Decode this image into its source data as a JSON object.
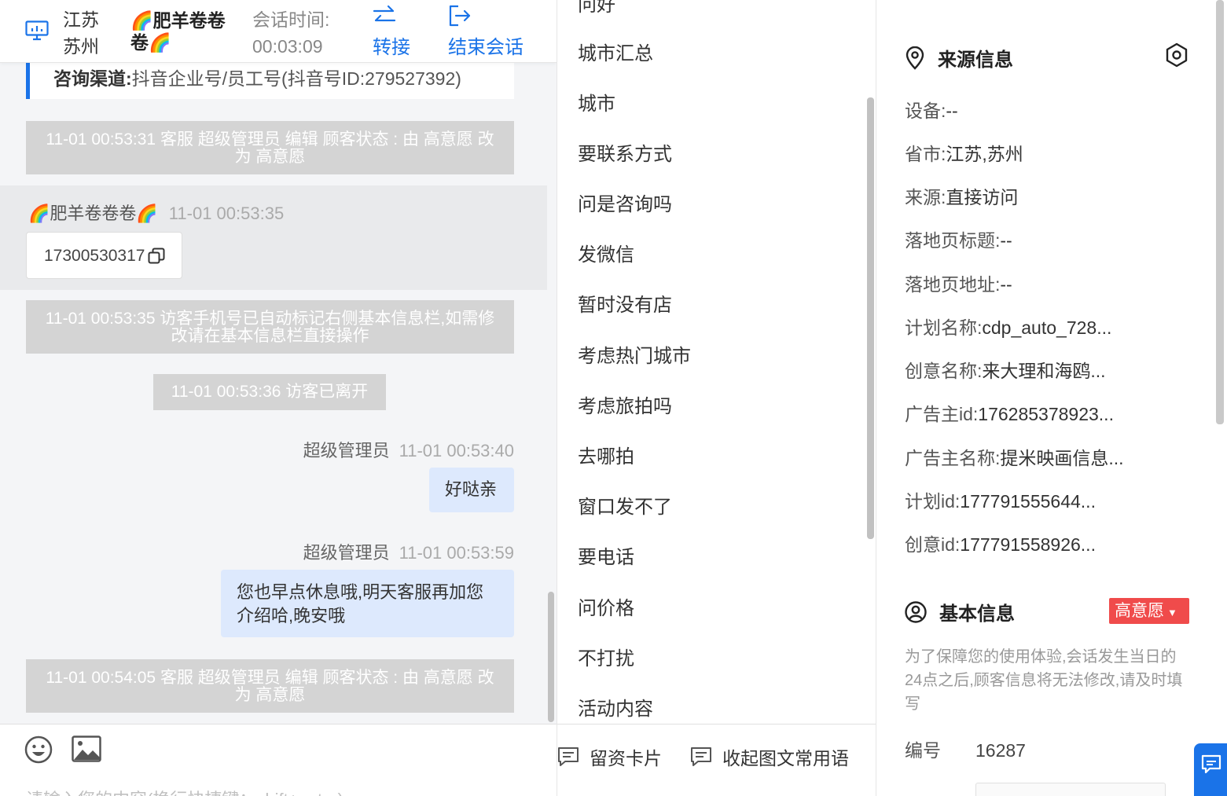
{
  "header": {
    "location": "江苏 苏州",
    "visitor_name": "🌈肥羊卷卷卷🌈",
    "session_time_label": "会话时间:",
    "session_time_value": "00:03:09",
    "transfer_label": "转接",
    "end_session_label": "结束会话"
  },
  "chat": {
    "channel_label": "咨询渠道:",
    "channel_value": "抖音企业号/员工号(抖音号ID:279527392)",
    "system_messages": [
      "11-01 00:53:31 客服 超级管理员 编辑 顾客状态 : 由 高意愿 改为 高意愿",
      "11-01 00:53:35 访客手机号已自动标记右侧基本信息栏,如需修改请在基本信息栏直接操作",
      "11-01 00:53:36 访客已离开",
      "11-01 00:54:05 客服 超级管理员 编辑 顾客状态 : 由 高意愿 改为 高意愿"
    ],
    "visitor_message": {
      "sender": "🌈肥羊卷卷卷🌈",
      "time": "11-01 00:53:35",
      "text": "17300530317"
    },
    "agent_messages": [
      {
        "sender": "超级管理员",
        "time": "11-01 00:53:40",
        "text": "好哒亲"
      },
      {
        "sender": "超级管理员",
        "time": "11-01 00:53:59",
        "text": "您也早点休息哦,明天客服再加您介绍哈,晚安哦"
      }
    ],
    "input_placeholder": "请输入您的内容(换行快捷键：shift+enter)"
  },
  "quick_replies": {
    "partial_top_item": "问好",
    "items": [
      "城市汇总",
      "城市",
      "要联系方式",
      "问是咨询吗",
      "发微信",
      "暂时没有店",
      "考虑热门城市",
      "考虑旅拍吗",
      "去哪拍",
      "窗口发不了",
      "要电话",
      "问价格",
      "不打扰",
      "活动内容"
    ],
    "card_label": "留资卡片",
    "collapse_label": "收起图文常用语"
  },
  "info": {
    "source_title": "来源信息",
    "source_rows": [
      {
        "key": "设备:",
        "value": "--"
      },
      {
        "key": "省市:",
        "value": "江苏,苏州"
      },
      {
        "key": "来源:",
        "value": "直接访问"
      },
      {
        "key": "落地页标题:",
        "value": "--"
      },
      {
        "key": "落地页地址:",
        "value": "--"
      },
      {
        "key": "计划名称:",
        "value": "cdp_auto_728..."
      },
      {
        "key": "创意名称:",
        "value": "来大理和海鸥..."
      },
      {
        "key": "广告主id:",
        "value": "176285378923..."
      },
      {
        "key": "广告主名称:",
        "value": "提米映画信息..."
      },
      {
        "key": "计划id:",
        "value": "177791555644..."
      },
      {
        "key": "创意id:",
        "value": "177791558926..."
      }
    ],
    "basic_title": "基本信息",
    "intent_badge": "高意愿",
    "basic_note": "为了保障您的使用体验,会话发生当日的24点之后,顾客信息将无法修改,请及时填写",
    "id_label": "编号",
    "id_value": "16287"
  },
  "colors": {
    "accent": "#1a73e8",
    "badge_red": "#f04b4b",
    "system_msg_bg": "#d4d4d4",
    "agent_bubble_bg": "#dde9fd"
  }
}
